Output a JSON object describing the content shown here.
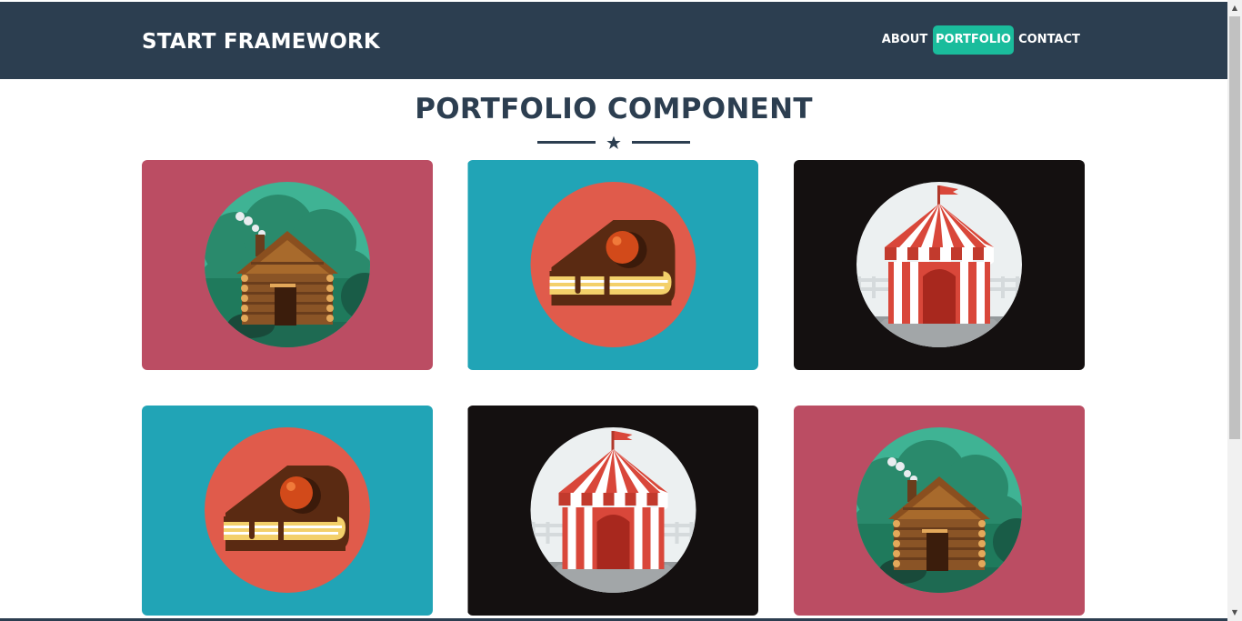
{
  "header": {
    "brand": "START FRAMEWORK",
    "nav": [
      {
        "label": "ABOUT",
        "active": false
      },
      {
        "label": "PORTFOLIO",
        "active": true
      },
      {
        "label": "CONTACT",
        "active": false
      }
    ]
  },
  "section": {
    "title": "PORTFOLIO COMPONENT"
  },
  "colors": {
    "navbar": "#2c3e50",
    "accent": "#1abc9c",
    "cabin_bg": "#bb4d63",
    "cake_bg": "#21a4b6",
    "circus_bg": "#141010"
  },
  "portfolio": [
    {
      "icon": "cabin-icon",
      "background": "#bb4d63"
    },
    {
      "icon": "cake-icon",
      "background": "#21a4b6"
    },
    {
      "icon": "circus-tent-icon",
      "background": "#141010"
    },
    {
      "icon": "cake-icon",
      "background": "#21a4b6"
    },
    {
      "icon": "circus-tent-icon",
      "background": "#141010"
    },
    {
      "icon": "cabin-icon",
      "background": "#bb4d63"
    }
  ]
}
